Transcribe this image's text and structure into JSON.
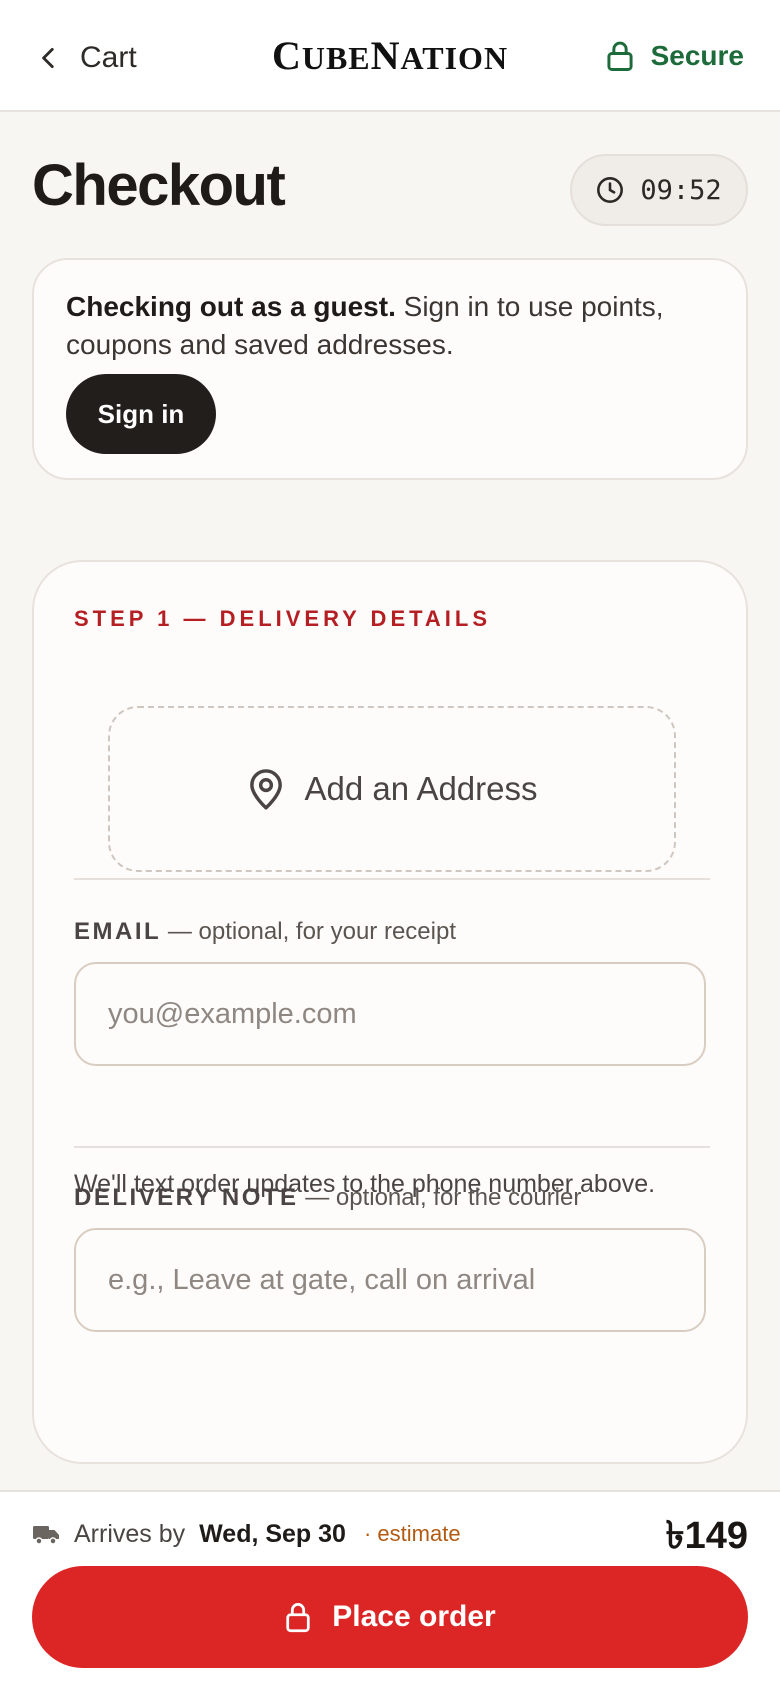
{
  "header": {
    "back_label": "Cart",
    "brand_c": "C",
    "brand_ube": "UBE",
    "brand_n": "N",
    "brand_ation": "ATION",
    "secure_label": "Secure"
  },
  "page": {
    "title": "Checkout",
    "timer": "09:52"
  },
  "guest": {
    "bold_text": "Checking out as a guest.",
    "text": " Sign in to use points, coupons and saved addresses.",
    "sign_in_label": "Sign in"
  },
  "delivery": {
    "step_label": "STEP 1 — DELIVERY DETAILS",
    "add_address_label": "Add an Address",
    "email_label": "EMAIL",
    "email_hint": " — optional, for your receipt",
    "email_placeholder": "you@example.com",
    "email_value": "",
    "helper_text": "We'll text order updates to the phone number above.",
    "note_label": "DELIVERY NOTE",
    "note_hint": " — optional, for the courier",
    "note_placeholder": "e.g., Leave at gate, call on arrival",
    "note_value": ""
  },
  "footer": {
    "arrives_prefix": "Arrives by",
    "arrives_date": "Wed, Sep 30",
    "estimate_label": "· estimate",
    "total": "৳149",
    "place_order_label": "Place order"
  },
  "colors": {
    "accent_red": "#dc2626",
    "step_red": "#b51f24",
    "secure_green": "#1d6b3a",
    "estimate_orange": "#b35a12"
  },
  "icons": {
    "back": "chevron-left-icon",
    "secure": "lock-icon",
    "timer": "clock-icon",
    "address": "map-pin-icon",
    "eta": "truck-icon",
    "place_order": "lock-icon"
  }
}
